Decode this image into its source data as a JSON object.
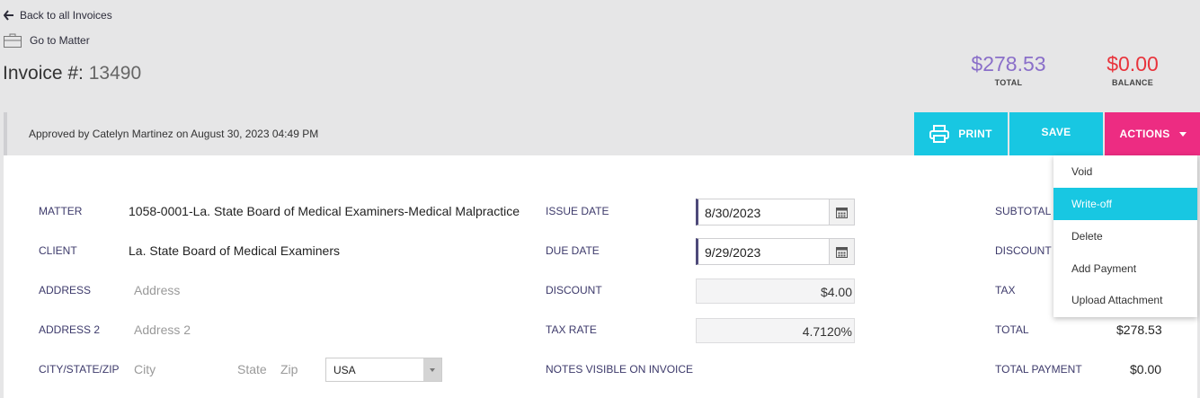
{
  "nav": {
    "back_label": "Back to all Invoices",
    "matter_label": "Go to Matter"
  },
  "invoice": {
    "title_prefix": "Invoice #:",
    "number": "13490"
  },
  "summary": {
    "total_amount": "$278.53",
    "total_label": "TOTAL",
    "balance_amount": "$0.00",
    "balance_label": "BALANCE",
    "total_color": "#8a6fc9",
    "balance_color": "#e8343c"
  },
  "toolbar": {
    "approved_text": "Approved by Catelyn Martinez on August 30, 2023 04:49 PM",
    "print_label": "PRINT",
    "save_label": "SAVE",
    "actions_label": "ACTIONS",
    "accent_color": "#18c7e2",
    "actions_color": "#ed2c82"
  },
  "actions_menu": {
    "items": [
      "Void",
      "Write-off",
      "Delete",
      "Add Payment",
      "Upload Attachment"
    ],
    "highlighted": "Write-off"
  },
  "form": {
    "matter_label": "MATTER",
    "matter_value": "1058-0001-La. State Board of Medical Examiners-Medical Malpractice",
    "client_label": "CLIENT",
    "client_value": "La. State Board of Medical Examiners",
    "address_label": "ADDRESS",
    "address_placeholder": "Address",
    "address2_label": "ADDRESS 2",
    "address2_placeholder": "Address 2",
    "csz_label": "CITY/STATE/ZIP",
    "city_placeholder": "City",
    "state_placeholder": "State",
    "zip_placeholder": "Zip",
    "country_value": "USA",
    "issue_date_label": "ISSUE DATE",
    "issue_date_value": "8/30/2023",
    "due_date_label": "DUE DATE",
    "due_date_value": "9/29/2023",
    "discount_label": "DISCOUNT",
    "discount_value": "$4.00",
    "tax_rate_label": "TAX RATE",
    "tax_rate_value": "4.7120%",
    "notes_label": "NOTES VISIBLE ON INVOICE"
  },
  "totals": {
    "subtotal_label": "SUBTOTAL",
    "discount_label": "DISCOUNT",
    "tax_label": "TAX",
    "total_label": "TOTAL",
    "total_value": "$278.53",
    "total_payment_label": "TOTAL PAYMENT",
    "total_payment_value": "$0.00"
  }
}
